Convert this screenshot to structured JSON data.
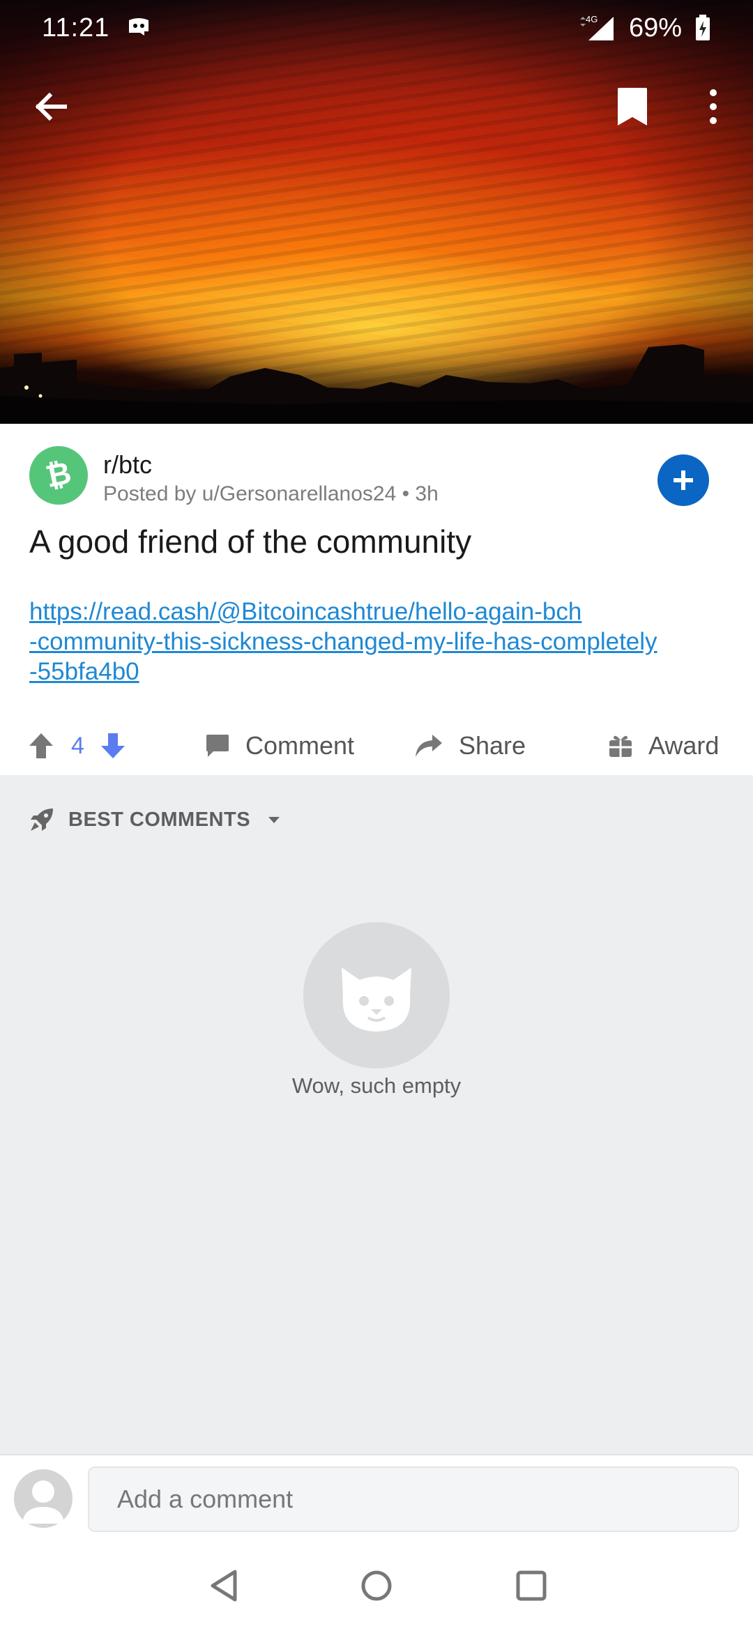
{
  "status_bar": {
    "time": "11:21",
    "network": "4G",
    "battery": "69%",
    "icons": [
      "ghost-icon",
      "signal-icon",
      "battery-charging-icon"
    ]
  },
  "toolbar": {
    "icons": [
      "back-arrow-icon",
      "bookmark-icon",
      "more-vertical-icon"
    ]
  },
  "post": {
    "subreddit": "r/btc",
    "meta": "Posted by u/Gersonarellanos24 • 3h",
    "title": "A good friend of the community",
    "link_lines": [
      "https://read.cash/@Bitcoincashtrue/hello-again-bch",
      "-community-this-sickness-changed-my-life-has-completely",
      "-55bfa4b0"
    ],
    "votes": "4",
    "actions": {
      "comment": "Comment",
      "share": "Share",
      "award": "Award"
    }
  },
  "comments": {
    "sort_label": "BEST COMMENTS",
    "empty_text": "Wow, such empty"
  },
  "comment_bar": {
    "placeholder": "Add a comment"
  },
  "colors": {
    "accent_blue": "#0a66c2",
    "subreddit_green": "#55c57a",
    "link": "#1e88d4",
    "vote": "#5b7cf0"
  }
}
